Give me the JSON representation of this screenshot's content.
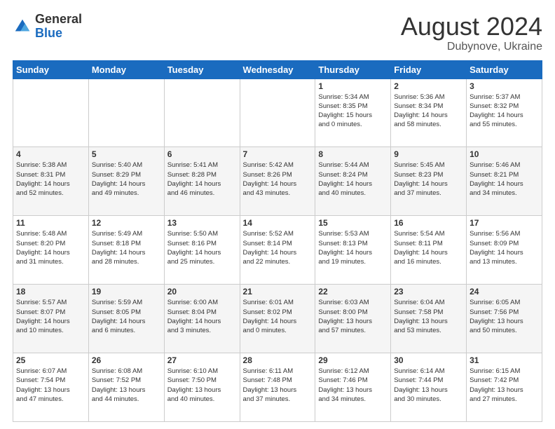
{
  "header": {
    "logo_general": "General",
    "logo_blue": "Blue",
    "month": "August 2024",
    "location": "Dubynove, Ukraine"
  },
  "days_of_week": [
    "Sunday",
    "Monday",
    "Tuesday",
    "Wednesday",
    "Thursday",
    "Friday",
    "Saturday"
  ],
  "weeks": [
    [
      {
        "day": "",
        "info": ""
      },
      {
        "day": "",
        "info": ""
      },
      {
        "day": "",
        "info": ""
      },
      {
        "day": "",
        "info": ""
      },
      {
        "day": "1",
        "info": "Sunrise: 5:34 AM\nSunset: 8:35 PM\nDaylight: 15 hours\nand 0 minutes."
      },
      {
        "day": "2",
        "info": "Sunrise: 5:36 AM\nSunset: 8:34 PM\nDaylight: 14 hours\nand 58 minutes."
      },
      {
        "day": "3",
        "info": "Sunrise: 5:37 AM\nSunset: 8:32 PM\nDaylight: 14 hours\nand 55 minutes."
      }
    ],
    [
      {
        "day": "4",
        "info": "Sunrise: 5:38 AM\nSunset: 8:31 PM\nDaylight: 14 hours\nand 52 minutes."
      },
      {
        "day": "5",
        "info": "Sunrise: 5:40 AM\nSunset: 8:29 PM\nDaylight: 14 hours\nand 49 minutes."
      },
      {
        "day": "6",
        "info": "Sunrise: 5:41 AM\nSunset: 8:28 PM\nDaylight: 14 hours\nand 46 minutes."
      },
      {
        "day": "7",
        "info": "Sunrise: 5:42 AM\nSunset: 8:26 PM\nDaylight: 14 hours\nand 43 minutes."
      },
      {
        "day": "8",
        "info": "Sunrise: 5:44 AM\nSunset: 8:24 PM\nDaylight: 14 hours\nand 40 minutes."
      },
      {
        "day": "9",
        "info": "Sunrise: 5:45 AM\nSunset: 8:23 PM\nDaylight: 14 hours\nand 37 minutes."
      },
      {
        "day": "10",
        "info": "Sunrise: 5:46 AM\nSunset: 8:21 PM\nDaylight: 14 hours\nand 34 minutes."
      }
    ],
    [
      {
        "day": "11",
        "info": "Sunrise: 5:48 AM\nSunset: 8:20 PM\nDaylight: 14 hours\nand 31 minutes."
      },
      {
        "day": "12",
        "info": "Sunrise: 5:49 AM\nSunset: 8:18 PM\nDaylight: 14 hours\nand 28 minutes."
      },
      {
        "day": "13",
        "info": "Sunrise: 5:50 AM\nSunset: 8:16 PM\nDaylight: 14 hours\nand 25 minutes."
      },
      {
        "day": "14",
        "info": "Sunrise: 5:52 AM\nSunset: 8:14 PM\nDaylight: 14 hours\nand 22 minutes."
      },
      {
        "day": "15",
        "info": "Sunrise: 5:53 AM\nSunset: 8:13 PM\nDaylight: 14 hours\nand 19 minutes."
      },
      {
        "day": "16",
        "info": "Sunrise: 5:54 AM\nSunset: 8:11 PM\nDaylight: 14 hours\nand 16 minutes."
      },
      {
        "day": "17",
        "info": "Sunrise: 5:56 AM\nSunset: 8:09 PM\nDaylight: 14 hours\nand 13 minutes."
      }
    ],
    [
      {
        "day": "18",
        "info": "Sunrise: 5:57 AM\nSunset: 8:07 PM\nDaylight: 14 hours\nand 10 minutes."
      },
      {
        "day": "19",
        "info": "Sunrise: 5:59 AM\nSunset: 8:05 PM\nDaylight: 14 hours\nand 6 minutes."
      },
      {
        "day": "20",
        "info": "Sunrise: 6:00 AM\nSunset: 8:04 PM\nDaylight: 14 hours\nand 3 minutes."
      },
      {
        "day": "21",
        "info": "Sunrise: 6:01 AM\nSunset: 8:02 PM\nDaylight: 14 hours\nand 0 minutes."
      },
      {
        "day": "22",
        "info": "Sunrise: 6:03 AM\nSunset: 8:00 PM\nDaylight: 13 hours\nand 57 minutes."
      },
      {
        "day": "23",
        "info": "Sunrise: 6:04 AM\nSunset: 7:58 PM\nDaylight: 13 hours\nand 53 minutes."
      },
      {
        "day": "24",
        "info": "Sunrise: 6:05 AM\nSunset: 7:56 PM\nDaylight: 13 hours\nand 50 minutes."
      }
    ],
    [
      {
        "day": "25",
        "info": "Sunrise: 6:07 AM\nSunset: 7:54 PM\nDaylight: 13 hours\nand 47 minutes."
      },
      {
        "day": "26",
        "info": "Sunrise: 6:08 AM\nSunset: 7:52 PM\nDaylight: 13 hours\nand 44 minutes."
      },
      {
        "day": "27",
        "info": "Sunrise: 6:10 AM\nSunset: 7:50 PM\nDaylight: 13 hours\nand 40 minutes."
      },
      {
        "day": "28",
        "info": "Sunrise: 6:11 AM\nSunset: 7:48 PM\nDaylight: 13 hours\nand 37 minutes."
      },
      {
        "day": "29",
        "info": "Sunrise: 6:12 AM\nSunset: 7:46 PM\nDaylight: 13 hours\nand 34 minutes."
      },
      {
        "day": "30",
        "info": "Sunrise: 6:14 AM\nSunset: 7:44 PM\nDaylight: 13 hours\nand 30 minutes."
      },
      {
        "day": "31",
        "info": "Sunrise: 6:15 AM\nSunset: 7:42 PM\nDaylight: 13 hours\nand 27 minutes."
      }
    ]
  ]
}
